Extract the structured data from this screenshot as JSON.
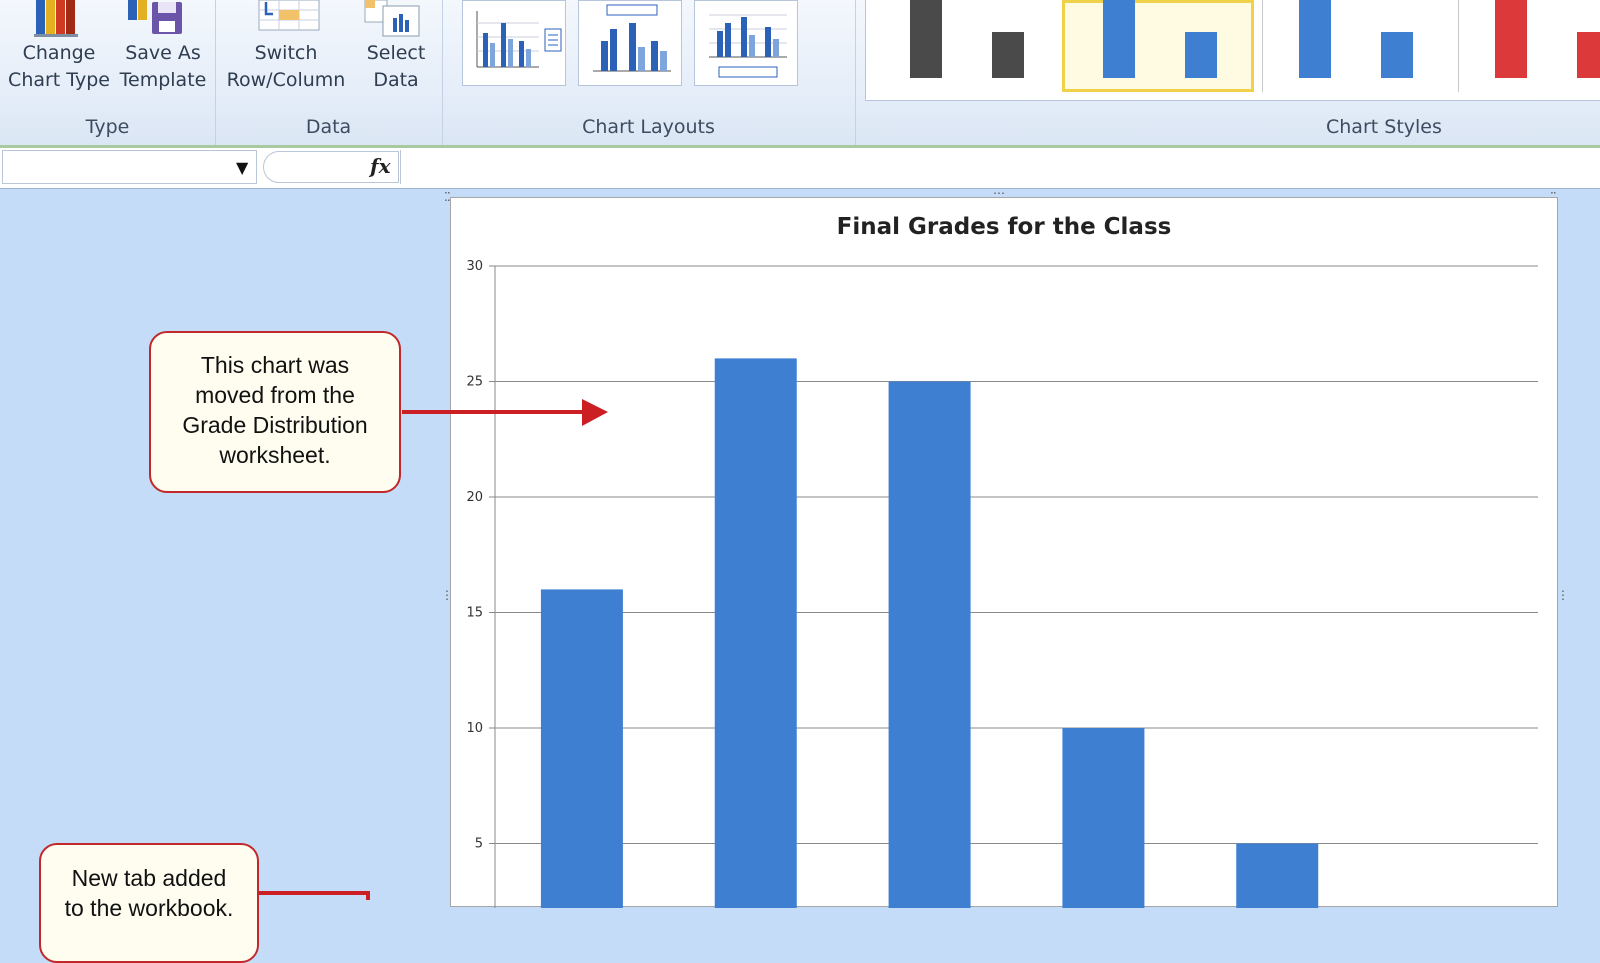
{
  "ribbon": {
    "type_group": {
      "label": "Type",
      "change_chart_type": [
        "Change",
        "Chart Type"
      ],
      "save_as_template": [
        "Save As",
        "Template"
      ]
    },
    "data_group": {
      "label": "Data",
      "switch_row_column": [
        "Switch",
        "Row/Column"
      ],
      "select_data": [
        "Select",
        "Data"
      ]
    },
    "chart_layouts_group": {
      "label": "Chart Layouts"
    },
    "chart_styles_group": {
      "label": "Chart Styles"
    }
  },
  "colors": {
    "bar": "#3f7fd1",
    "callout_border": "#c0282a",
    "arrow": "#cc1f24",
    "app_background": "#c5dcf8"
  },
  "chart_data": {
    "type": "bar",
    "title": "Final Grades for the Class",
    "categories": [
      "",
      "",
      "",
      "",
      "",
      ""
    ],
    "values": [
      16,
      26,
      25,
      10,
      5,
      0
    ],
    "ylim": [
      0,
      30
    ],
    "yticks": [
      5,
      10,
      15,
      20,
      25,
      30
    ],
    "grid": true,
    "xlabel": "",
    "ylabel": ""
  },
  "callouts": {
    "moved": [
      "This chart was",
      "moved from the",
      "Grade Distribution",
      "worksheet."
    ],
    "new_tab": [
      "New tab added",
      "to the workbook."
    ]
  }
}
